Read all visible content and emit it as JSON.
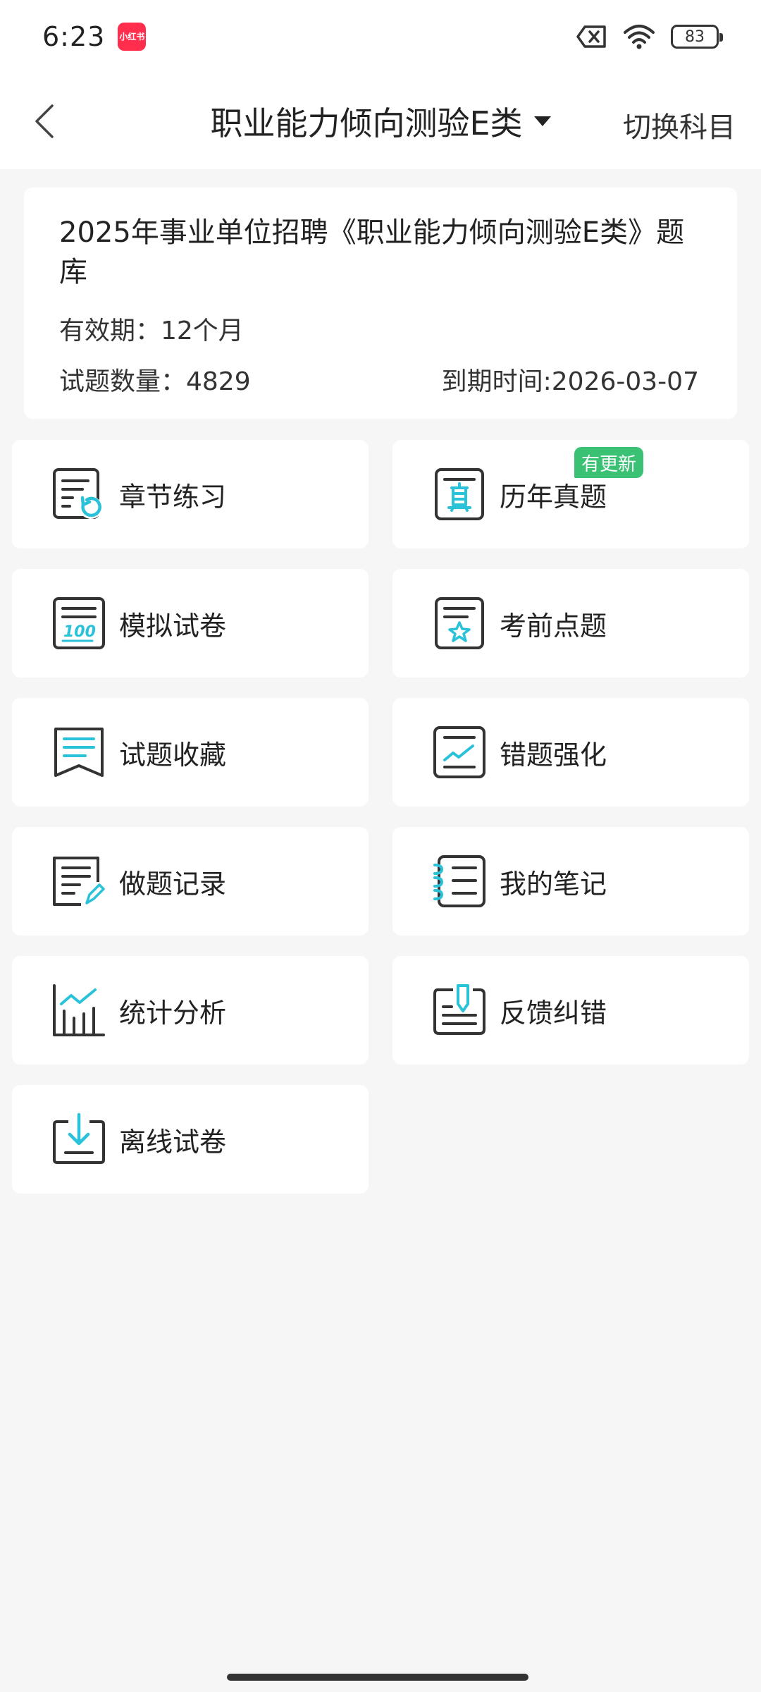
{
  "status_bar": {
    "time": "6:23",
    "app_badge_text": "小红书",
    "battery": "83",
    "icons": [
      "notification-mute-icon",
      "wifi-icon",
      "battery-icon"
    ]
  },
  "header": {
    "title": "职业能力倾向测验E类",
    "switch_label": "切换科目"
  },
  "info": {
    "title": "2025年事业单位招聘《职业能力倾向测验E类》题库",
    "validity": "有效期：12个月",
    "count": "试题数量：4829",
    "expire": "到期时间:2026-03-07"
  },
  "menu": {
    "chapter_practice": "章节练习",
    "past_papers": "历年真题",
    "past_papers_badge": "有更新",
    "mock_exam": "模拟试卷",
    "pre_exam_tips": "考前点题",
    "favorites": "试题收藏",
    "mistake_review": "错题强化",
    "practice_records": "做题记录",
    "my_notes": "我的笔记",
    "statistics": "统计分析",
    "feedback": "反馈纠错",
    "offline_papers": "离线试卷"
  },
  "colors": {
    "accent": "#29c2d8",
    "icon_stroke": "#333333",
    "badge": "#3ac173"
  }
}
